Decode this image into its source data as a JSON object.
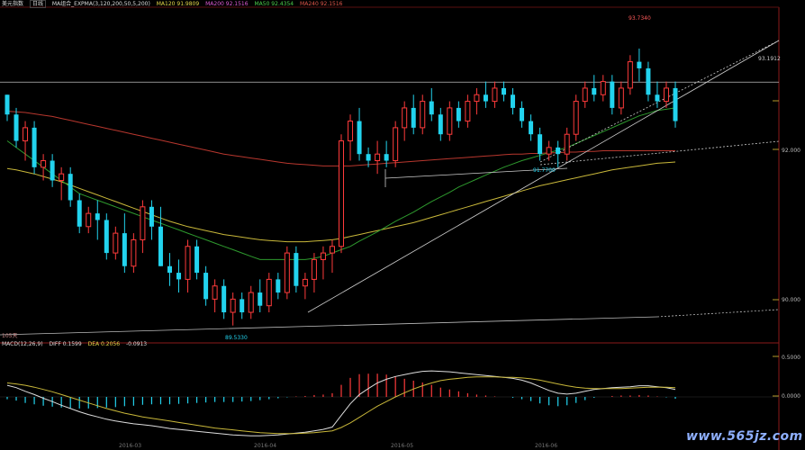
{
  "header": {
    "symbol": "美元指数",
    "period_btn": "日线",
    "indicators": [
      {
        "label": "MA组合_EXPMA(3,120,200,50,5,200)",
        "color": "#dddddd"
      },
      {
        "label": "MA120 91.9809",
        "color": "#e6d84a"
      },
      {
        "label": "MA200 92.1516",
        "color": "#e05bd6"
      },
      {
        "label": "MA50 92.4354",
        "color": "#4ccf4c"
      },
      {
        "label": "MA240 92.1516",
        "color": "#e0564a"
      }
    ]
  },
  "macd_header": {
    "items": [
      {
        "label": "MACD(12,26,9)",
        "color": "#dddddd"
      },
      {
        "label": "DIFF 0.1599",
        "color": "#dddddd"
      },
      {
        "label": "DEA 0.2056",
        "color": "#e6d84a"
      },
      {
        "label": "-0.0913",
        "color": "#dddddd"
      }
    ]
  },
  "period_label": "105天",
  "price_labels": {
    "high": "93.7340",
    "mid_low": "91.7700",
    "low": "89.5330",
    "hline": "93.1912"
  },
  "y_axis": {
    "price": [
      "92.000",
      "90.000"
    ],
    "macd": [
      "0.5000",
      "0.0000"
    ]
  },
  "x_axis": [
    "2016-03",
    "2016-04",
    "2016-05",
    "2016-06"
  ],
  "watermark": "www.565jz.com",
  "colors": {
    "up": "#ff3b3b",
    "down": "#22d3ee",
    "ma_green": "#2e9a2e",
    "ma_yellow": "#c9b83a",
    "ma_red": "#b8372e",
    "ma_olive": "#a8a830"
  },
  "chart_data": {
    "type": "candlestick",
    "ylim": [
      89.25,
      94.3
    ],
    "hline": 93.1912,
    "candles": [
      [
        93.0,
        93.0,
        92.6,
        92.7
      ],
      [
        92.7,
        92.8,
        92.2,
        92.3
      ],
      [
        92.3,
        92.6,
        92.0,
        92.5
      ],
      [
        92.5,
        92.6,
        91.8,
        91.9
      ],
      [
        91.9,
        92.1,
        91.7,
        92.0
      ],
      [
        92.0,
        92.1,
        91.6,
        91.7
      ],
      [
        91.7,
        91.9,
        91.4,
        91.8
      ],
      [
        91.8,
        91.9,
        91.3,
        91.4
      ],
      [
        91.4,
        91.5,
        90.9,
        91.0
      ],
      [
        91.0,
        91.3,
        90.9,
        91.2
      ],
      [
        91.2,
        91.4,
        90.8,
        91.1
      ],
      [
        91.1,
        91.2,
        90.5,
        90.6
      ],
      [
        90.6,
        91.0,
        90.5,
        90.9
      ],
      [
        90.9,
        91.2,
        90.3,
        90.4
      ],
      [
        90.4,
        90.9,
        90.3,
        90.8
      ],
      [
        90.8,
        91.4,
        90.6,
        91.3
      ],
      [
        91.3,
        91.4,
        90.8,
        91.0
      ],
      [
        91.0,
        91.3,
        90.4,
        90.4
      ],
      [
        90.4,
        90.6,
        90.1,
        90.3
      ],
      [
        90.3,
        90.5,
        90.0,
        90.2
      ],
      [
        90.2,
        90.8,
        90.0,
        90.7
      ],
      [
        90.7,
        90.8,
        90.2,
        90.3
      ],
      [
        90.3,
        90.4,
        89.8,
        89.9
      ],
      [
        89.9,
        90.2,
        89.7,
        90.1
      ],
      [
        90.1,
        90.2,
        89.6,
        89.7
      ],
      [
        89.7,
        90.0,
        89.5,
        89.9
      ],
      [
        89.9,
        90.0,
        89.6,
        89.7
      ],
      [
        89.7,
        90.1,
        89.6,
        90.0
      ],
      [
        90.0,
        90.2,
        89.7,
        89.8
      ],
      [
        89.8,
        90.3,
        89.7,
        90.2
      ],
      [
        90.2,
        90.3,
        89.9,
        90.0
      ],
      [
        90.0,
        90.7,
        89.9,
        90.6
      ],
      [
        90.6,
        90.7,
        90.0,
        90.1
      ],
      [
        90.1,
        90.3,
        89.9,
        90.2
      ],
      [
        90.2,
        90.6,
        90.0,
        90.5
      ],
      [
        90.5,
        90.7,
        90.2,
        90.6
      ],
      [
        90.6,
        90.8,
        90.3,
        90.7
      ],
      [
        90.7,
        92.4,
        90.6,
        92.3
      ],
      [
        92.3,
        92.7,
        92.0,
        92.6
      ],
      [
        92.6,
        92.8,
        92.0,
        92.1
      ],
      [
        92.1,
        92.2,
        91.9,
        92.0
      ],
      [
        92.0,
        92.3,
        91.8,
        92.1
      ],
      [
        92.1,
        92.3,
        91.9,
        92.0
      ],
      [
        92.0,
        92.6,
        91.9,
        92.5
      ],
      [
        92.5,
        92.9,
        92.3,
        92.8
      ],
      [
        92.8,
        93.0,
        92.4,
        92.5
      ],
      [
        92.5,
        93.0,
        92.4,
        92.9
      ],
      [
        92.9,
        93.1,
        92.6,
        92.7
      ],
      [
        92.7,
        92.8,
        92.3,
        92.4
      ],
      [
        92.4,
        92.9,
        92.3,
        92.8
      ],
      [
        92.8,
        92.9,
        92.5,
        92.6
      ],
      [
        92.6,
        93.0,
        92.5,
        92.9
      ],
      [
        92.9,
        93.1,
        92.7,
        93.0
      ],
      [
        93.0,
        93.2,
        92.8,
        92.9
      ],
      [
        92.9,
        93.2,
        92.8,
        93.1
      ],
      [
        93.1,
        93.2,
        92.9,
        93.0
      ],
      [
        93.0,
        93.1,
        92.7,
        92.8
      ],
      [
        92.8,
        92.9,
        92.5,
        92.6
      ],
      [
        92.6,
        92.7,
        92.3,
        92.4
      ],
      [
        92.4,
        92.5,
        92.0,
        92.1
      ],
      [
        92.1,
        92.3,
        92.0,
        92.2
      ],
      [
        92.2,
        92.3,
        91.9,
        92.1
      ],
      [
        92.1,
        92.5,
        92.0,
        92.4
      ],
      [
        92.4,
        93.0,
        92.3,
        92.9
      ],
      [
        92.9,
        93.2,
        92.8,
        93.1
      ],
      [
        93.1,
        93.3,
        92.9,
        93.0
      ],
      [
        93.0,
        93.3,
        92.9,
        93.2
      ],
      [
        93.2,
        93.3,
        92.7,
        92.8
      ],
      [
        92.8,
        93.2,
        92.7,
        93.1
      ],
      [
        93.1,
        93.6,
        93.0,
        93.5
      ],
      [
        93.5,
        93.7,
        93.2,
        93.4
      ],
      [
        93.4,
        93.5,
        92.9,
        93.0
      ],
      [
        93.0,
        93.2,
        92.8,
        92.9
      ],
      [
        92.9,
        93.2,
        92.8,
        93.1
      ],
      [
        93.1,
        93.2,
        92.5,
        92.6
      ]
    ],
    "ma_green": [
      92.3,
      92.2,
      92.1,
      92.0,
      91.9,
      91.8,
      91.7,
      91.6,
      91.5,
      91.45,
      91.4,
      91.35,
      91.3,
      91.25,
      91.2,
      91.15,
      91.1,
      91.05,
      91.0,
      90.95,
      90.9,
      90.85,
      90.8,
      90.75,
      90.7,
      90.65,
      90.6,
      90.55,
      90.5,
      90.5,
      90.5,
      90.5,
      90.5,
      90.5,
      90.52,
      90.55,
      90.6,
      90.65,
      90.7,
      90.78,
      90.85,
      90.92,
      91.0,
      91.08,
      91.15,
      91.22,
      91.3,
      91.38,
      91.45,
      91.52,
      91.6,
      91.66,
      91.72,
      91.78,
      91.84,
      91.9,
      91.95,
      92.0,
      92.04,
      92.08,
      92.12,
      92.16,
      92.2,
      92.26,
      92.32,
      92.38,
      92.44,
      92.5,
      92.56,
      92.62,
      92.68,
      92.72,
      92.76,
      92.78,
      92.8
    ],
    "ma_yellow": [
      91.88,
      91.86,
      91.83,
      91.8,
      91.76,
      91.72,
      91.68,
      91.63,
      91.58,
      91.53,
      91.48,
      91.43,
      91.38,
      91.33,
      91.28,
      91.23,
      91.18,
      91.13,
      91.08,
      91.04,
      91.0,
      90.97,
      90.94,
      90.91,
      90.88,
      90.86,
      90.84,
      90.82,
      90.8,
      90.79,
      90.78,
      90.77,
      90.77,
      90.77,
      90.78,
      90.79,
      90.8,
      90.82,
      90.85,
      90.88,
      90.91,
      90.94,
      90.97,
      91.0,
      91.03,
      91.06,
      91.1,
      91.14,
      91.18,
      91.22,
      91.26,
      91.3,
      91.34,
      91.38,
      91.42,
      91.46,
      91.5,
      91.54,
      91.58,
      91.62,
      91.65,
      91.68,
      91.71,
      91.74,
      91.77,
      91.8,
      91.83,
      91.86,
      91.88,
      91.9,
      91.92,
      91.94,
      91.96,
      91.97,
      91.98
    ],
    "ma_red": [
      92.75,
      92.74,
      92.73,
      92.71,
      92.69,
      92.67,
      92.64,
      92.61,
      92.58,
      92.55,
      92.52,
      92.49,
      92.46,
      92.43,
      92.4,
      92.37,
      92.34,
      92.31,
      92.28,
      92.25,
      92.22,
      92.19,
      92.16,
      92.13,
      92.1,
      92.08,
      92.06,
      92.04,
      92.02,
      92.0,
      91.98,
      91.96,
      91.95,
      91.94,
      91.93,
      91.92,
      91.92,
      91.92,
      91.92,
      91.93,
      91.94,
      91.95,
      91.96,
      91.97,
      91.98,
      91.99,
      92.0,
      92.01,
      92.02,
      92.03,
      92.04,
      92.05,
      92.06,
      92.07,
      92.08,
      92.09,
      92.1,
      92.1,
      92.11,
      92.11,
      92.12,
      92.12,
      92.13,
      92.13,
      92.14,
      92.14,
      92.15,
      92.15,
      92.15,
      92.15,
      92.15,
      92.15,
      92.15,
      92.15,
      92.15
    ],
    "macd": {
      "ylim": [
        -0.95,
        0.95
      ],
      "diff": [
        0.25,
        0.2,
        0.12,
        0.05,
        -0.03,
        -0.1,
        -0.18,
        -0.25,
        -0.32,
        -0.38,
        -0.43,
        -0.48,
        -0.52,
        -0.55,
        -0.58,
        -0.6,
        -0.62,
        -0.65,
        -0.68,
        -0.7,
        -0.72,
        -0.74,
        -0.76,
        -0.78,
        -0.8,
        -0.82,
        -0.83,
        -0.84,
        -0.84,
        -0.83,
        -0.82,
        -0.8,
        -0.78,
        -0.76,
        -0.73,
        -0.7,
        -0.65,
        -0.4,
        -0.15,
        0.05,
        0.18,
        0.3,
        0.38,
        0.44,
        0.48,
        0.52,
        0.55,
        0.56,
        0.55,
        0.54,
        0.52,
        0.5,
        0.48,
        0.46,
        0.44,
        0.42,
        0.4,
        0.36,
        0.3,
        0.22,
        0.14,
        0.08,
        0.06,
        0.08,
        0.12,
        0.16,
        0.18,
        0.2,
        0.21,
        0.22,
        0.24,
        0.24,
        0.22,
        0.2,
        0.16
      ],
      "dea": [
        0.3,
        0.28,
        0.25,
        0.21,
        0.16,
        0.11,
        0.05,
        -0.01,
        -0.07,
        -0.13,
        -0.19,
        -0.25,
        -0.3,
        -0.35,
        -0.39,
        -0.43,
        -0.46,
        -0.49,
        -0.52,
        -0.55,
        -0.58,
        -0.61,
        -0.64,
        -0.67,
        -0.69,
        -0.71,
        -0.73,
        -0.75,
        -0.77,
        -0.78,
        -0.79,
        -0.79,
        -0.79,
        -0.78,
        -0.77,
        -0.75,
        -0.73,
        -0.66,
        -0.56,
        -0.44,
        -0.32,
        -0.2,
        -0.1,
        0.0,
        0.09,
        0.17,
        0.24,
        0.3,
        0.35,
        0.38,
        0.4,
        0.42,
        0.43,
        0.43,
        0.43,
        0.42,
        0.42,
        0.41,
        0.39,
        0.36,
        0.32,
        0.28,
        0.24,
        0.21,
        0.19,
        0.18,
        0.18,
        0.18,
        0.18,
        0.19,
        0.2,
        0.21,
        0.21,
        0.21,
        0.2
      ],
      "hist": [
        -0.05,
        -0.08,
        -0.13,
        -0.16,
        -0.19,
        -0.21,
        -0.23,
        -0.24,
        -0.25,
        -0.25,
        -0.24,
        -0.23,
        -0.22,
        -0.2,
        -0.19,
        -0.17,
        -0.16,
        -0.16,
        -0.16,
        -0.15,
        -0.14,
        -0.13,
        -0.12,
        -0.11,
        -0.11,
        -0.11,
        -0.1,
        -0.09,
        -0.07,
        -0.05,
        -0.03,
        -0.01,
        0.01,
        0.02,
        0.04,
        0.05,
        0.08,
        0.26,
        0.41,
        0.49,
        0.5,
        0.5,
        0.48,
        0.44,
        0.39,
        0.35,
        0.31,
        0.26,
        0.2,
        0.16,
        0.12,
        0.08,
        0.05,
        0.03,
        0.01,
        0.0,
        -0.02,
        -0.05,
        -0.09,
        -0.14,
        -0.18,
        -0.2,
        -0.18,
        -0.13,
        -0.07,
        -0.02,
        0.0,
        0.02,
        0.03,
        0.03,
        0.04,
        0.03,
        0.01,
        -0.01,
        -0.04
      ]
    }
  }
}
